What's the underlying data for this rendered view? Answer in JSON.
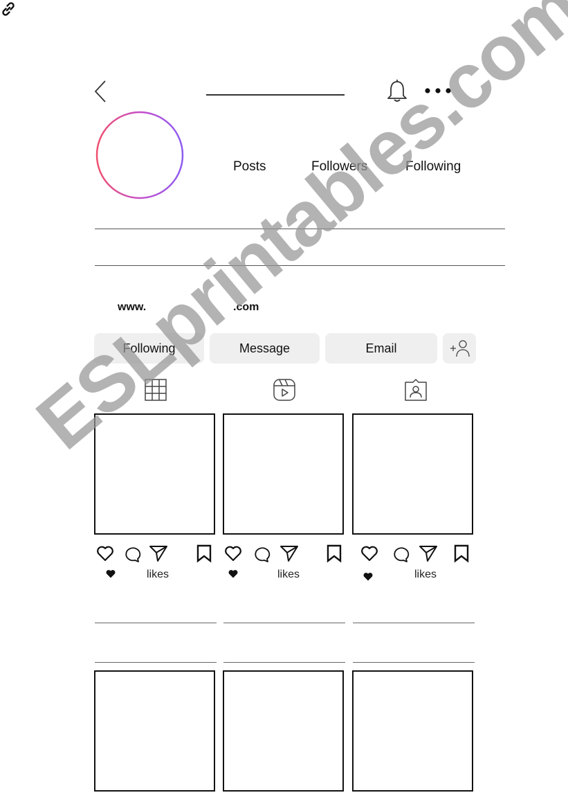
{
  "header": {
    "back_icon": "chevron-left-icon",
    "username": "",
    "notification_icon": "bell-icon",
    "more_icon": "more-horizontal-icon"
  },
  "profile": {
    "avatar_ring_colors": [
      "#f0506e",
      "#c04fd0",
      "#8c5cf0"
    ],
    "stats": [
      {
        "label": "Posts",
        "value": ""
      },
      {
        "label": "Followers",
        "value": ""
      },
      {
        "label": "Following",
        "value": ""
      }
    ],
    "bio_lines": [
      "",
      ""
    ]
  },
  "website": {
    "icon": "link-icon",
    "prefix": "www.",
    "domain": "",
    "suffix": ".com"
  },
  "actions": {
    "following_label": "Following",
    "message_label": "Message",
    "email_label": "Email",
    "add_user_icon": "add-person-icon"
  },
  "tabs": [
    {
      "name": "posts-grid",
      "icon": "grid-icon"
    },
    {
      "name": "reels",
      "icon": "reels-icon"
    },
    {
      "name": "tagged",
      "icon": "tagged-person-icon"
    }
  ],
  "posts": [
    {
      "likes_label": "likes",
      "likes_count": "",
      "caption_lines": [
        "",
        ""
      ]
    },
    {
      "likes_label": "likes",
      "likes_count": "",
      "caption_lines": [
        "",
        ""
      ]
    },
    {
      "likes_label": "likes",
      "likes_count": "",
      "caption_lines": [
        "",
        ""
      ]
    },
    {},
    {},
    {}
  ],
  "watermark": {
    "text": "ESLprintables.com",
    "color": "#969696"
  }
}
